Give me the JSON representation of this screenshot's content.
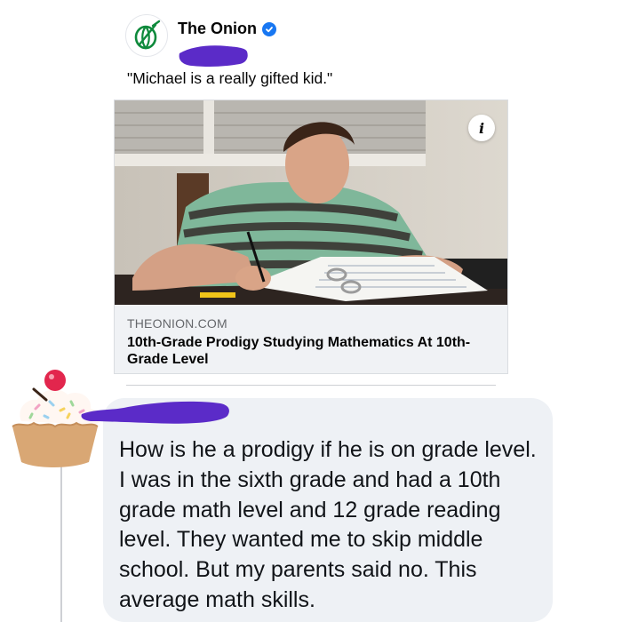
{
  "post": {
    "page_name": "The Onion",
    "caption": "\"Michael is a really gifted kid.\""
  },
  "link_preview": {
    "domain": "THEONION.COM",
    "title": "10th-Grade Prodigy Studying Mathematics At 10th-Grade Level",
    "info_label": "i"
  },
  "comment": {
    "text": "How is he a prodigy if he is on grade level. I was in the sixth grade and had a 10th grade math level and 12 grade reading level. They wanted me to skip middle school. But my parents said no. This average math skills."
  },
  "icons": {
    "page_avatar": "onion-logo-icon",
    "verified": "verified-badge-icon",
    "info": "info-icon",
    "commenter_avatar": "cupcake-icon"
  },
  "colors": {
    "verified_blue": "#1877f2",
    "onion_green": "#0f8a3c",
    "redaction_purple": "#5b2bc8",
    "comment_bubble": "#eef1f5"
  }
}
